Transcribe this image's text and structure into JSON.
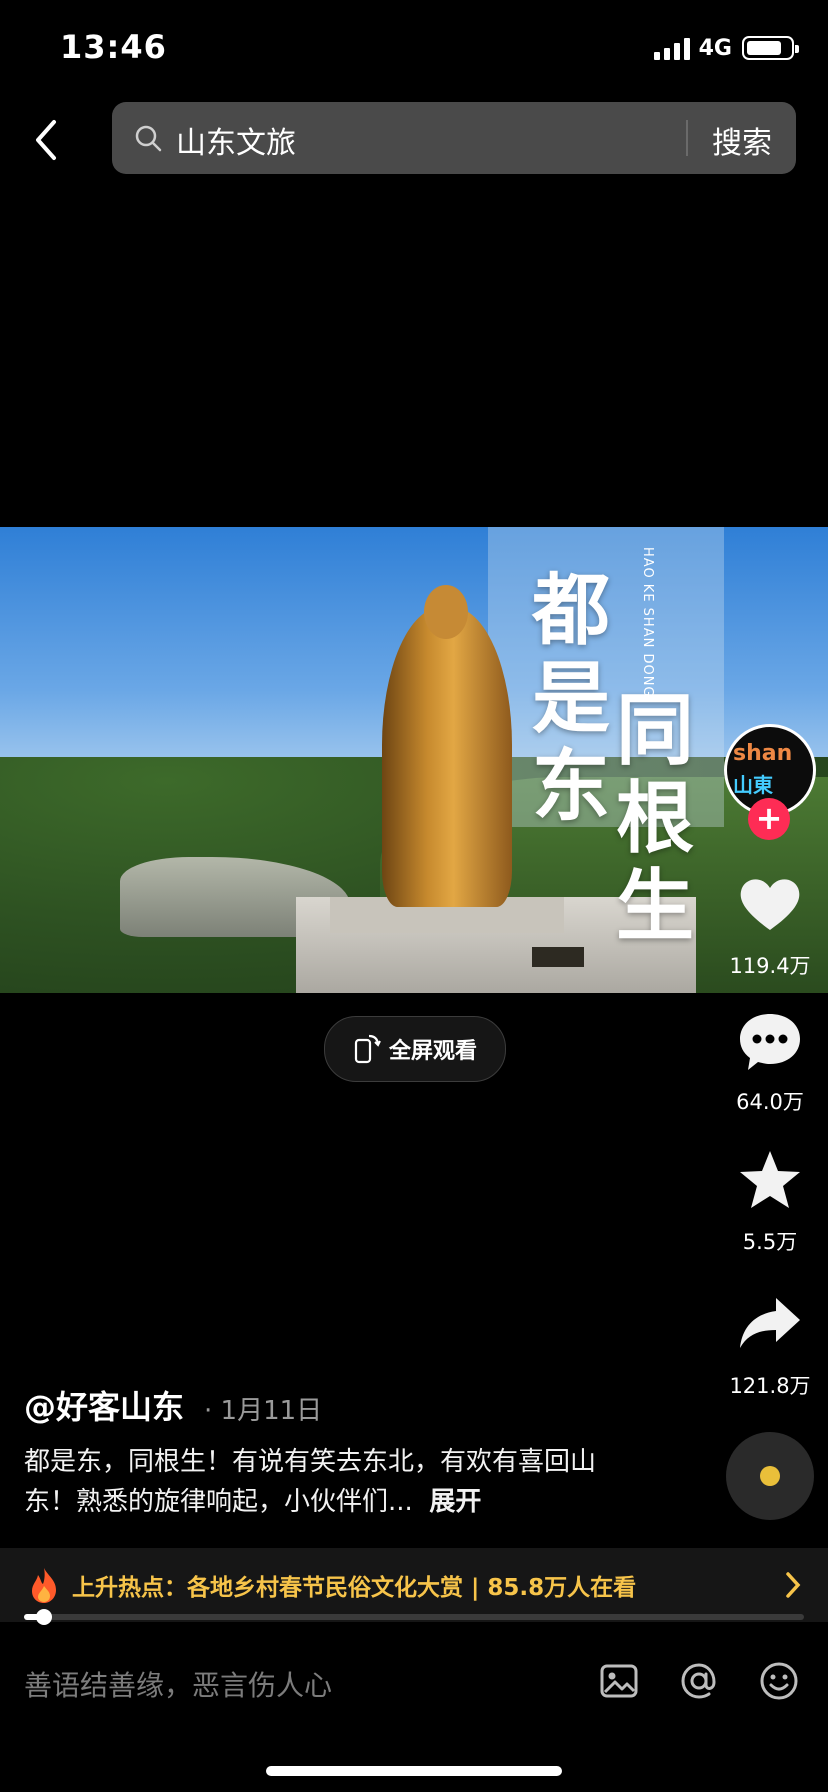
{
  "status": {
    "time": "13:46",
    "network": "4G",
    "battery_level": 0.8
  },
  "search": {
    "query": "山东文旅",
    "button_label": "搜索"
  },
  "video": {
    "title_chars_left": "都是东",
    "title_chars_right": "同根生",
    "subtitle": "HAO KE SHAN DONG"
  },
  "fullscreen": {
    "label": "全屏观看"
  },
  "avatar": {
    "line1": "shan",
    "line2": "山東"
  },
  "rail": {
    "likes": "119.4万",
    "comments": "64.0万",
    "favorites": "5.5万",
    "shares": "121.8万"
  },
  "post": {
    "author": "@好客山东",
    "date": "· 1月11日",
    "description": "都是东，同根生！有说有笑去东北，有欢有喜回山东！熟悉的旋律响起，小伙伴们...",
    "expand_label": "展开"
  },
  "hot": {
    "text": "上升热点：各地乡村春节民俗文化大赏 | 85.8万人在看"
  },
  "progress": {
    "played_fraction": 0.025
  },
  "comment_bar": {
    "placeholder": "善语结善缘，恶言伤人心"
  },
  "colors": {
    "hot_text": "#f7c44a",
    "follow": "#fe2c55",
    "music_dot": "#e9bf3a"
  },
  "icons": [
    "back-arrow-icon",
    "search-icon",
    "rotate-phone-icon",
    "heart-icon",
    "comment-icon",
    "star-icon",
    "share-icon",
    "flame-icon",
    "chevron-right-icon",
    "image-icon",
    "at-icon",
    "emoji-icon"
  ]
}
